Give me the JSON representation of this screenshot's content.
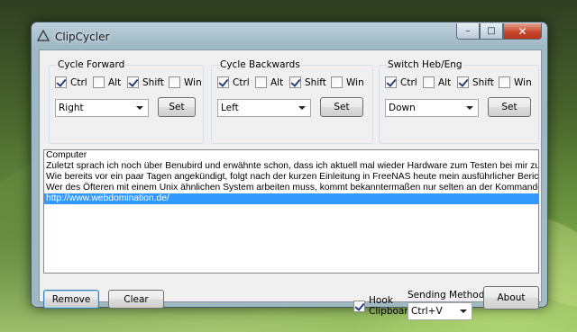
{
  "window": {
    "title": "ClipCycler",
    "caption": {
      "minimize": "–",
      "maximize": "□",
      "close": "✕"
    }
  },
  "groups": [
    {
      "title": "Cycle Forward",
      "ctrl": {
        "label": "Ctrl",
        "checked": true
      },
      "alt": {
        "label": "Alt",
        "checked": false
      },
      "shift": {
        "label": "Shift",
        "checked": true
      },
      "win": {
        "label": "Win",
        "checked": false
      },
      "key": "Right",
      "set_label": "Set"
    },
    {
      "title": "Cycle Backwards",
      "ctrl": {
        "label": "Ctrl",
        "checked": true
      },
      "alt": {
        "label": "Alt",
        "checked": false
      },
      "shift": {
        "label": "Shift",
        "checked": true
      },
      "win": {
        "label": "Win",
        "checked": false
      },
      "key": "Left",
      "set_label": "Set"
    },
    {
      "title": "Switch Heb/Eng",
      "ctrl": {
        "label": "Ctrl",
        "checked": true
      },
      "alt": {
        "label": "Alt",
        "checked": false
      },
      "shift": {
        "label": "Shift",
        "checked": true
      },
      "win": {
        "label": "Win",
        "checked": false
      },
      "key": "Down",
      "set_label": "Set"
    }
  ],
  "clipboard_list": [
    "Computer",
    "Zuletzt sprach ich noch über Benubird und erwähnte schon, dass ich aktuell mal wieder Hardware zum Testen bei mir zu Hause liegen",
    "Wie bereits vor ein paar Tagen angekündigt, folgt nach der kurzen Einleitung in FreeNAS heute mein ausführlicher Bericht zum NAS-B",
    "Wer des Öfteren mit einem Unix ähnlichen System arbeiten muss, kommt bekanntermaßen nur selten an der Kommandozeile vorbei, so",
    "http://www.webdomination.de/"
  ],
  "selected_item": 4,
  "footer": {
    "remove_label": "Remove",
    "clear_label": "Clear",
    "hook_label_1": "Hook",
    "hook_label_2": "Clipboard",
    "hook_checked": true,
    "sending_method_label": "Sending Method",
    "sending_method_value": "Ctrl+V",
    "about_label": "About"
  },
  "colors": {
    "selection": "#3399ff",
    "close_button": "#c7472c",
    "window_frame": "#aac4d6"
  }
}
